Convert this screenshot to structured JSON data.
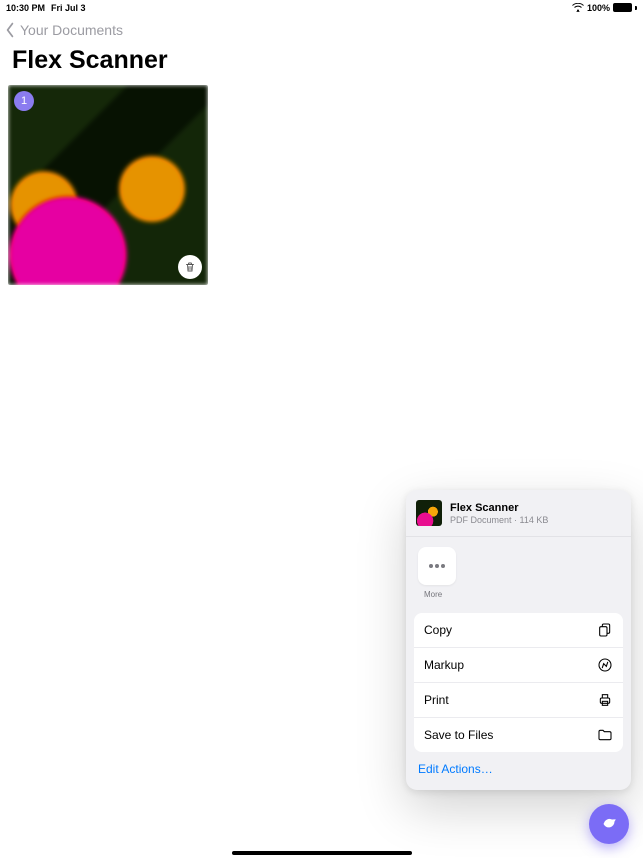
{
  "status": {
    "time": "10:30 PM",
    "date": "Fri Jul 3",
    "battery": "100%"
  },
  "nav": {
    "back_label": "Your Documents"
  },
  "page": {
    "title": "Flex Scanner",
    "page_badge": "1"
  },
  "share": {
    "title": "Flex Scanner",
    "subtitle": "PDF Document · 114 KB",
    "more_label": "More",
    "actions": {
      "copy": "Copy",
      "markup": "Markup",
      "print": "Print",
      "save": "Save to Files"
    },
    "edit_actions": "Edit Actions…"
  }
}
